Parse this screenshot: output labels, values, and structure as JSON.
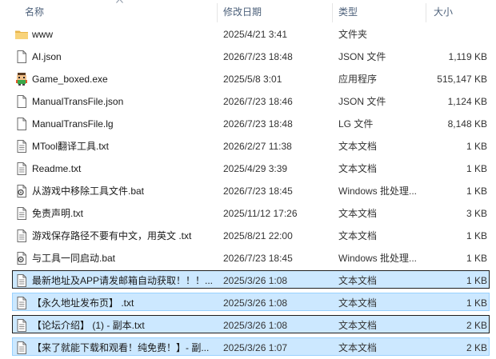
{
  "header": {
    "name": "名称",
    "date": "修改日期",
    "type": "类型",
    "size": "大小"
  },
  "rows": [
    {
      "name": "www",
      "date": "2025/4/21 3:41",
      "type": "文件夹",
      "size": "",
      "icon": "folder-icon"
    },
    {
      "name": "AI.json",
      "date": "2026/7/23 18:48",
      "type": "JSON 文件",
      "size": "1,119 KB",
      "icon": "file-icon"
    },
    {
      "name": "Game_boxed.exe",
      "date": "2025/5/8 3:01",
      "type": "应用程序",
      "size": "515,147 KB",
      "icon": "app-icon"
    },
    {
      "name": "ManualTransFile.json",
      "date": "2026/7/23 18:46",
      "type": "JSON 文件",
      "size": "1,124 KB",
      "icon": "file-icon"
    },
    {
      "name": "ManualTransFile.lg",
      "date": "2026/7/23 18:48",
      "type": "LG 文件",
      "size": "8,148 KB",
      "icon": "file-icon"
    },
    {
      "name": "MTool翻译工具.txt",
      "date": "2026/2/27 11:38",
      "type": "文本文档",
      "size": "1 KB",
      "icon": "text-file-icon"
    },
    {
      "name": "Readme.txt",
      "date": "2025/4/29 3:39",
      "type": "文本文档",
      "size": "1 KB",
      "icon": "text-file-icon"
    },
    {
      "name": "从游戏中移除工具文件.bat",
      "date": "2026/7/23 18:45",
      "type": "Windows 批处理...",
      "size": "1 KB",
      "icon": "batch-file-icon"
    },
    {
      "name": "免责声明.txt",
      "date": "2025/11/12 17:26",
      "type": "文本文档",
      "size": "3 KB",
      "icon": "text-file-icon"
    },
    {
      "name": "游戏保存路径不要有中文，用英文 .txt",
      "date": "2025/8/21 22:00",
      "type": "文本文档",
      "size": "1 KB",
      "icon": "text-file-icon"
    },
    {
      "name": "与工具一同启动.bat",
      "date": "2026/7/23 18:45",
      "type": "Windows 批处理...",
      "size": "1 KB",
      "icon": "batch-file-icon"
    },
    {
      "name": "最新地址及APP请发邮箱自动获取！！！...",
      "date": "2025/3/26 1:08",
      "type": "文本文档",
      "size": "1 KB",
      "icon": "text-file-icon",
      "selected": true,
      "focus": true
    },
    {
      "name": "【永久地址发布页】 .txt",
      "date": "2025/3/26 1:08",
      "type": "文本文档",
      "size": "1 KB",
      "icon": "text-file-icon",
      "selected": true
    },
    {
      "name": "【论坛介绍】 (1) - 副本.txt",
      "date": "2025/3/26 1:08",
      "type": "文本文档",
      "size": "2 KB",
      "icon": "text-file-icon",
      "selected": true,
      "focus": true
    },
    {
      "name": "【来了就能下载和观看！纯免费！】- 副...",
      "date": "2025/3/26 1:07",
      "type": "文本文档",
      "size": "2 KB",
      "icon": "text-file-icon",
      "selected": true
    }
  ]
}
